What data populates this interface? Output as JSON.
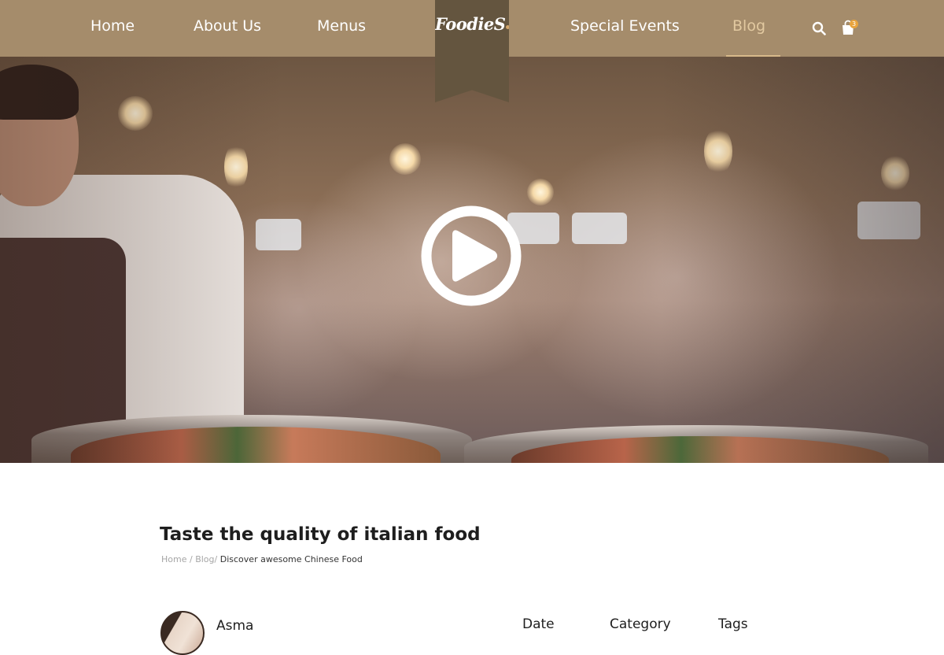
{
  "nav": {
    "items": [
      {
        "label": "Home"
      },
      {
        "label": "About Us"
      },
      {
        "label": "Menus"
      },
      {
        "label": "Special Events"
      },
      {
        "label": "Blog"
      }
    ],
    "active": "Blog",
    "cart_count": "3",
    "icons": [
      "search-icon",
      "cart-icon"
    ]
  },
  "logo": {
    "text": "FoodieS"
  },
  "hero": {
    "icon": "play-icon"
  },
  "post": {
    "title": "Taste the quality of italian food",
    "breadcrumb": {
      "home": "Home",
      "blog": "Blog",
      "separator": "/",
      "current": "Discover awesome Chinese Food"
    },
    "author": "Asma",
    "meta_labels": {
      "date": "Date",
      "category": "Category",
      "tags": "Tags"
    }
  },
  "colors": {
    "nav_background": "#a58c6b",
    "logo_ribbon": "#64553f",
    "active_link": "#e2c9a0",
    "cart_badge": "#e8a33c"
  }
}
